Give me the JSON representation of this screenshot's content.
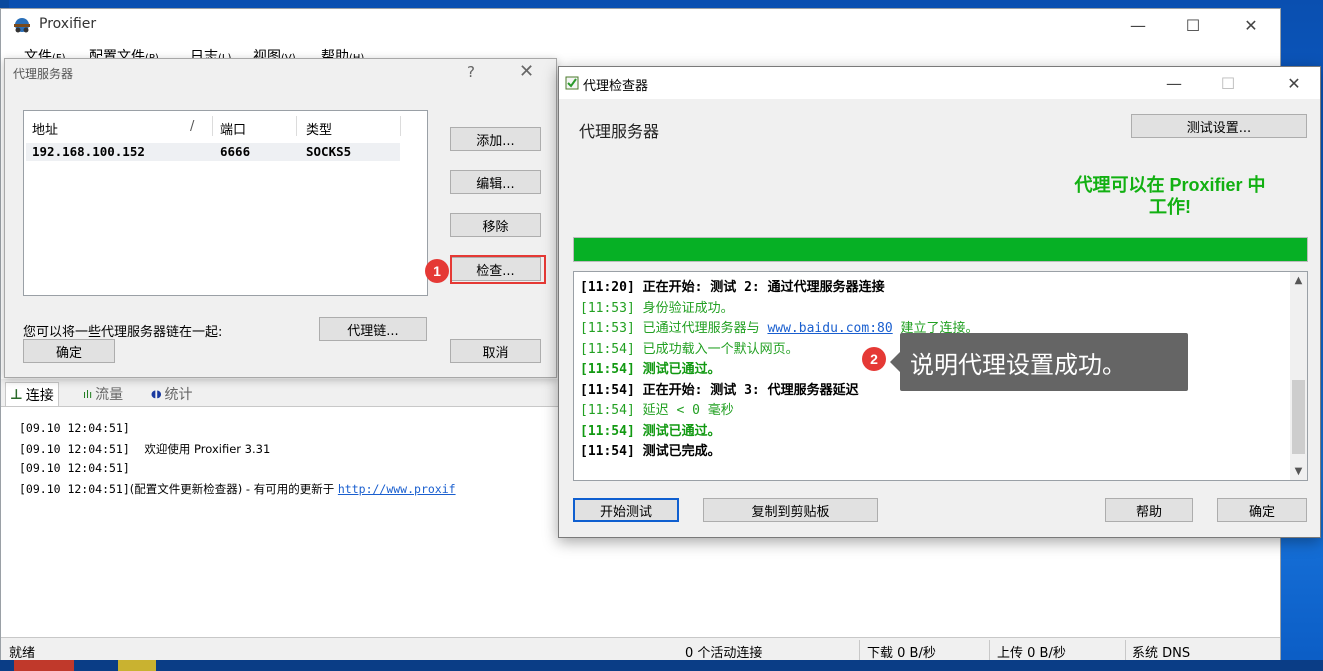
{
  "main_window": {
    "title": "Proxifier",
    "menu": [
      {
        "label": "文件",
        "key": "(F)"
      },
      {
        "label": "配置文件",
        "key": "(P)"
      },
      {
        "label": "日志",
        "key": "(L)"
      },
      {
        "label": "视图",
        "key": "(V)"
      },
      {
        "label": "帮助",
        "key": "(H)"
      }
    ],
    "tabs": [
      "连接",
      "流量",
      "统计"
    ],
    "log": [
      {
        "time": "[09.10 12:04:51]",
        "text": ""
      },
      {
        "time": "[09.10 12:04:51]",
        "text": "    欢迎使用 Proxifier 3.31"
      },
      {
        "time": "[09.10 12:04:51]",
        "text": ""
      },
      {
        "time": "[09.10 12:04:51]",
        "text": "(配置文件更新检查器) - 有可用的更新于 ",
        "link": "http://www.proxif"
      }
    ],
    "status": {
      "ready": "就绪",
      "connections": "0 个活动连接",
      "download": "下载 0 B/秒",
      "upload": "上传 0 B/秒",
      "dns": "系统 DNS"
    }
  },
  "servers_dialog": {
    "title": "代理服务器",
    "help": "?",
    "columns": {
      "address": "地址",
      "sort": "/",
      "port": "端口",
      "type": "类型"
    },
    "rows": [
      {
        "address": "192.168.100.152",
        "port": "6666",
        "type": "SOCKS5"
      }
    ],
    "buttons": {
      "add": "添加...",
      "edit": "编辑...",
      "remove": "移除",
      "check": "检查...",
      "chain": "代理链...",
      "ok": "确定",
      "cancel": "取消"
    },
    "chain_text": "您可以将一些代理服务器链在一起:"
  },
  "checker": {
    "title": "代理检查器",
    "heading": "代理服务器",
    "settings_button": "测试设置...",
    "status_line1": "代理可以在 Proxifier 中",
    "status_line2": "工作!",
    "progress": 1.0,
    "log": [
      {
        "style": "black-bold",
        "text": "[11:20] 正在开始: 测试 2: 通过代理服务器连接"
      },
      {
        "style": "green",
        "text": "[11:53] 身份验证成功。"
      },
      {
        "style": "green",
        "text": "[11:53] 已通过代理服务器与 ",
        "link": "www.baidu.com:80",
        "after": " 建立了连接。"
      },
      {
        "style": "green",
        "text": "[11:54] 已成功载入一个默认网页。"
      },
      {
        "style": "green-bold",
        "text": "[11:54] 测试已通过。"
      },
      {
        "style": "black-bold",
        "text": "[11:54] 正在开始: 测试 3: 代理服务器延迟"
      },
      {
        "style": "green",
        "text": "[11:54] 延迟 < 0 毫秒"
      },
      {
        "style": "green-bold",
        "text": "[11:54] 测试已通过。"
      },
      {
        "style": "black-bold",
        "text": "[11:54] 测试已完成。"
      }
    ],
    "buttons": {
      "start": "开始测试",
      "copy": "复制到剪贴板",
      "help": "帮助",
      "ok": "确定"
    }
  },
  "annotations": {
    "step1": "1",
    "step2": "2",
    "callout": "说明代理设置成功。"
  },
  "colors": {
    "accent_green": "#06b025",
    "highlight_red": "#e53935",
    "link_blue": "#1a5fcf"
  }
}
